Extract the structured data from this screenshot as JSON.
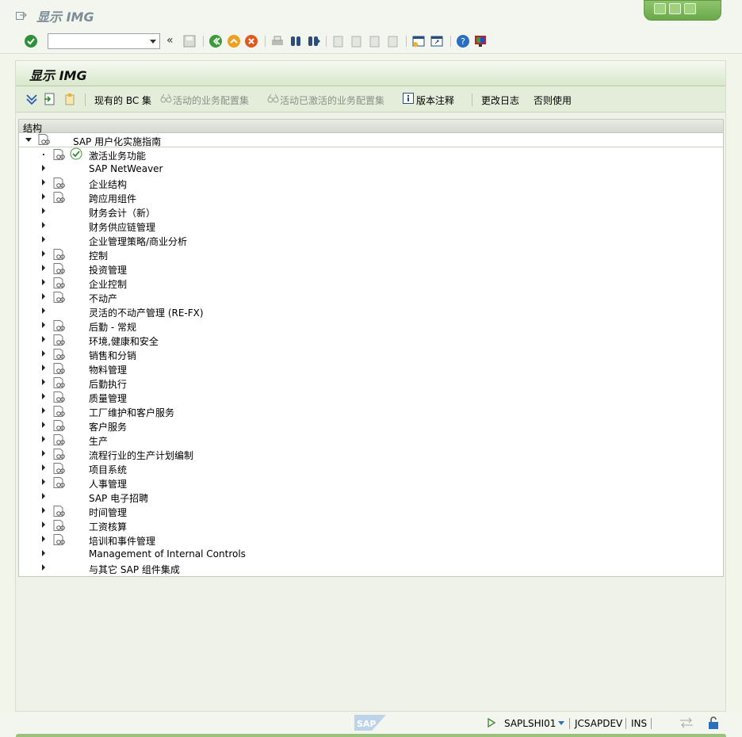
{
  "window": {
    "title": "显示 IMG"
  },
  "panel": {
    "title": "显示 IMG"
  },
  "app_toolbar": {
    "existing_bc_sets": "现有的 BC 集",
    "active_bc_sets": "活动的业务配置集",
    "activated_bc_sets": "活动已激活的业务配置集",
    "release_notes": "版本注释",
    "change_log": "更改日志",
    "where_used": "否则使用"
  },
  "tree": {
    "column_header": "结构",
    "root": "SAP 用户化实施指南",
    "items": [
      {
        "label": "激活业务功能",
        "doc": true,
        "special": true
      },
      {
        "label": "SAP NetWeaver",
        "doc": false
      },
      {
        "label": "企业结构",
        "doc": true
      },
      {
        "label": "跨应用组件",
        "doc": true
      },
      {
        "label": "财务会计（新）",
        "doc": false
      },
      {
        "label": "财务供应链管理",
        "doc": false
      },
      {
        "label": "企业管理策略/商业分析",
        "doc": false
      },
      {
        "label": "控制",
        "doc": true
      },
      {
        "label": "投资管理",
        "doc": true
      },
      {
        "label": "企业控制",
        "doc": true
      },
      {
        "label": "不动产",
        "doc": true
      },
      {
        "label": "灵活的不动产管理 (RE-FX)",
        "doc": false
      },
      {
        "label": "后勤 - 常规",
        "doc": true
      },
      {
        "label": "环境,健康和安全",
        "doc": true
      },
      {
        "label": "销售和分销",
        "doc": true
      },
      {
        "label": "物料管理",
        "doc": true
      },
      {
        "label": "后勤执行",
        "doc": true
      },
      {
        "label": "质量管理",
        "doc": true
      },
      {
        "label": "工厂维护和客户服务",
        "doc": true
      },
      {
        "label": "客户服务",
        "doc": true
      },
      {
        "label": "生产",
        "doc": true
      },
      {
        "label": "流程行业的生产计划编制",
        "doc": true
      },
      {
        "label": "项目系统",
        "doc": true
      },
      {
        "label": "人事管理",
        "doc": true
      },
      {
        "label": "SAP 电子招聘",
        "doc": false
      },
      {
        "label": "时间管理",
        "doc": true
      },
      {
        "label": "工资核算",
        "doc": true
      },
      {
        "label": "培训和事件管理",
        "doc": true
      },
      {
        "label": "Management of Internal Controls",
        "doc": false
      },
      {
        "label": "与其它 SAP 组件集成",
        "doc": false
      }
    ]
  },
  "status": {
    "program": "SAPLSHI01",
    "system": "JCSAPDEV",
    "mode": "INS"
  },
  "colors": {
    "accent": "#6aa84a",
    "background": "#f1f5ea",
    "panel_header": "#d9e8cc"
  }
}
